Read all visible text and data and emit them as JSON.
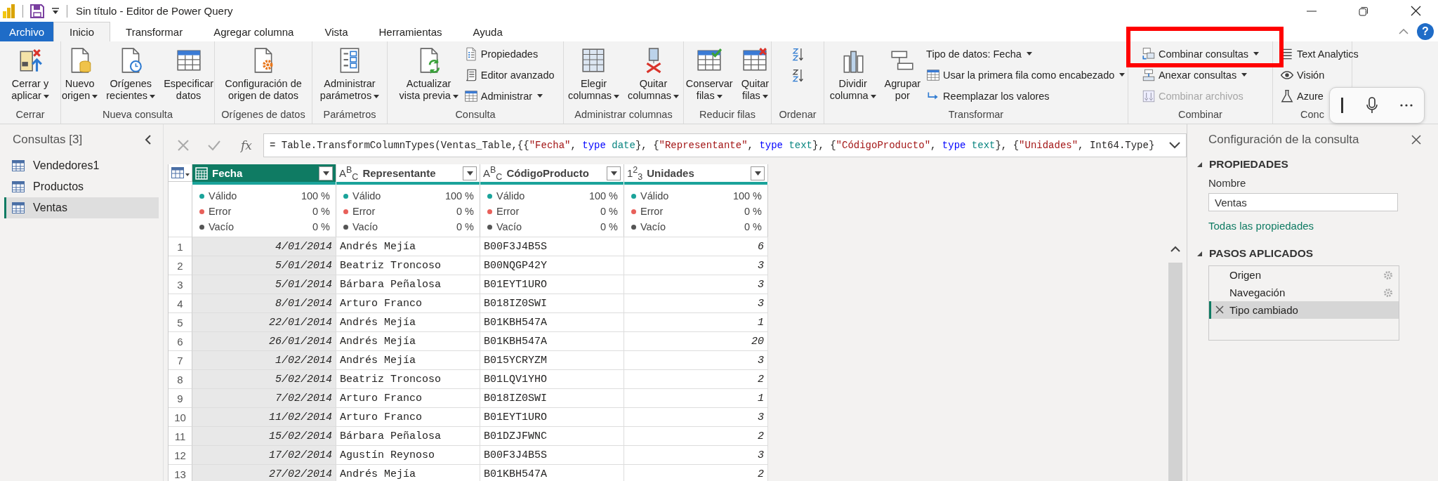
{
  "title_bar": {
    "title": "Sin título - Editor de Power Query"
  },
  "menu_tabs": [
    {
      "label": "Archivo",
      "kind": "file",
      "selected": false
    },
    {
      "label": "Inicio",
      "kind": "tab",
      "selected": true
    },
    {
      "label": "Transformar",
      "kind": "tab",
      "selected": false
    },
    {
      "label": "Agregar columna",
      "kind": "tab",
      "selected": false
    },
    {
      "label": "Vista",
      "kind": "tab",
      "selected": false
    },
    {
      "label": "Herramientas",
      "kind": "tab",
      "selected": false
    },
    {
      "label": "Ayuda",
      "kind": "tab",
      "selected": false
    }
  ],
  "help_label": "?",
  "ribbon": [
    {
      "label": "Cerrar",
      "items": [
        {
          "kind": "large",
          "lines": [
            "Cerrar y",
            "aplicar"
          ],
          "dropdown": true
        }
      ]
    },
    {
      "label": "Nueva consulta",
      "items": [
        {
          "kind": "large",
          "lines": [
            "Nuevo",
            "origen"
          ],
          "dropdown": true
        },
        {
          "kind": "large",
          "lines": [
            "Orígenes",
            "recientes"
          ],
          "dropdown": true
        },
        {
          "kind": "large",
          "lines": [
            "Especificar",
            "datos"
          ]
        }
      ]
    },
    {
      "label": "Orígenes de datos",
      "items": [
        {
          "kind": "large",
          "lines": [
            "Configuración de",
            "origen de datos"
          ]
        }
      ]
    },
    {
      "label": "Parámetros",
      "items": [
        {
          "kind": "large",
          "lines": [
            "Administrar",
            "parámetros"
          ],
          "dropdown": true
        }
      ]
    },
    {
      "label": "Consulta",
      "items": [
        {
          "kind": "large",
          "lines": [
            "Actualizar",
            "vista previa"
          ],
          "dropdown": true
        },
        {
          "kind": "small",
          "label": "Propiedades"
        },
        {
          "kind": "small",
          "label": "Editor avanzado"
        },
        {
          "kind": "small",
          "label": "Administrar",
          "dropdown": true
        }
      ]
    },
    {
      "label": "Administrar columnas",
      "items": [
        {
          "kind": "large",
          "lines": [
            "Elegir",
            "columnas"
          ],
          "dropdown": true
        },
        {
          "kind": "large",
          "lines": [
            "Quitar",
            "columnas"
          ],
          "dropdown": true
        }
      ]
    },
    {
      "label": "Reducir filas",
      "items": [
        {
          "kind": "large",
          "lines": [
            "Conservar",
            "filas"
          ],
          "dropdown": true
        },
        {
          "kind": "large",
          "lines": [
            "Quitar",
            "filas"
          ],
          "dropdown": true
        }
      ]
    },
    {
      "label": "Ordenar",
      "items": [
        {
          "kind": "icon"
        },
        {
          "kind": "icon"
        }
      ]
    },
    {
      "label": "Transformar",
      "items": [
        {
          "kind": "large",
          "lines": [
            "Dividir",
            "columna"
          ],
          "dropdown": true
        },
        {
          "kind": "large",
          "lines": [
            "Agrupar",
            "por"
          ]
        },
        {
          "kind": "small",
          "label": "Tipo de datos: Fecha",
          "dropdown": true
        },
        {
          "kind": "small",
          "label": "Usar la primera fila como encabezado",
          "dropdown": true
        },
        {
          "kind": "small",
          "label": "Reemplazar los valores"
        }
      ]
    },
    {
      "label": "Combinar",
      "items": [
        {
          "kind": "small",
          "label": "Combinar consultas",
          "dropdown": true,
          "disabled": false
        },
        {
          "kind": "small",
          "label": "Anexar consultas",
          "dropdown": true,
          "disabled": false
        },
        {
          "kind": "small",
          "label": "Combinar archivos",
          "disabled": true
        }
      ]
    },
    {
      "label": "Conc",
      "items": [
        {
          "kind": "small",
          "label": "Text Analytics"
        },
        {
          "kind": "small",
          "label": "Visión"
        },
        {
          "kind": "small",
          "label": "Azure"
        }
      ]
    }
  ],
  "queries": {
    "title": "Consultas [3]",
    "items": [
      {
        "label": "Vendedores1",
        "selected": false
      },
      {
        "label": "Productos",
        "selected": false
      },
      {
        "label": "Ventas",
        "selected": true
      }
    ]
  },
  "formula_bar": {
    "function_label": "fx",
    "tokens": [
      {
        "kind": "plain",
        "text": "= Table.TransformColumnTypes(Ventas_Table,{{"
      },
      {
        "kind": "string",
        "text": "\"Fecha\""
      },
      {
        "kind": "plain",
        "text": ", "
      },
      {
        "kind": "keyword",
        "text": "type"
      },
      {
        "kind": "type",
        "text": " date"
      },
      {
        "kind": "plain",
        "text": "}, {"
      },
      {
        "kind": "string",
        "text": "\"Representante\""
      },
      {
        "kind": "plain",
        "text": ", "
      },
      {
        "kind": "keyword",
        "text": "type"
      },
      {
        "kind": "type",
        "text": " text"
      },
      {
        "kind": "plain",
        "text": "}, {"
      },
      {
        "kind": "string",
        "text": "\"CódigoProducto\""
      },
      {
        "kind": "plain",
        "text": ", "
      },
      {
        "kind": "keyword",
        "text": "type"
      },
      {
        "kind": "type",
        "text": " text"
      },
      {
        "kind": "plain",
        "text": "}, {"
      },
      {
        "kind": "string",
        "text": "\"Unidades\""
      },
      {
        "kind": "plain",
        "text": ", Int64.Type}"
      }
    ]
  },
  "table": {
    "columns": [
      {
        "name": "Fecha",
        "kind": "date",
        "selected": true,
        "level": 1,
        "quality": [
          {
            "label": "Válido",
            "value": "100 %",
            "color": "#1aa39a"
          },
          {
            "label": "Error",
            "value": "0 %",
            "color": "#e8605a"
          },
          {
            "label": "Vacío",
            "value": "0 %",
            "color": "#555555"
          }
        ]
      },
      {
        "name": "Representante",
        "kind": "text",
        "type_label": "A$^{B}$$_{C}$",
        "selected": false,
        "level": 1,
        "quality": [
          {
            "label": "Válido",
            "value": "100 %",
            "color": "#1aa39a"
          },
          {
            "label": "Error",
            "value": "0 %",
            "color": "#e8605a"
          },
          {
            "label": "Vacío",
            "value": "0 %",
            "color": "#555555"
          }
        ]
      },
      {
        "name": "CódigoProducto",
        "kind": "text",
        "type_label": "A$^{B}$$_{C}$",
        "selected": false,
        "level": 1,
        "quality": [
          {
            "label": "Válido",
            "value": "100 %",
            "color": "#1aa39a"
          },
          {
            "label": "Error",
            "value": "0 %",
            "color": "#e8605a"
          },
          {
            "label": "Vacío",
            "value": "0 %",
            "color": "#555555"
          }
        ]
      },
      {
        "name": "Unidades",
        "kind": "number",
        "type_label": "1$^{2}$$_{3}$",
        "selected": false,
        "level": 1,
        "quality": [
          {
            "label": "Válido",
            "value": "100 %",
            "color": "#1aa39a"
          },
          {
            "label": "Error",
            "value": "0 %",
            "color": "#e8605a"
          },
          {
            "label": "Vacío",
            "value": "0 %",
            "color": "#555555"
          }
        ]
      }
    ],
    "rows": [
      {
        "number": "1",
        "cells": [
          "4/01/2014",
          "Andrés Mejía",
          "B00F3J4B5S",
          "6"
        ]
      },
      {
        "number": "2",
        "cells": [
          "5/01/2014",
          "Beatriz Troncoso",
          "B00NQGP42Y",
          "3"
        ]
      },
      {
        "number": "3",
        "cells": [
          "5/01/2014",
          "Bárbara Peñalosa",
          "B01EYT1URO",
          "3"
        ]
      },
      {
        "number": "4",
        "cells": [
          "8/01/2014",
          "Arturo Franco",
          "B018IZ0SWI",
          "3"
        ]
      },
      {
        "number": "5",
        "cells": [
          "22/01/2014",
          "Andrés Mejía",
          "B01KBH547A",
          "1"
        ]
      },
      {
        "number": "6",
        "cells": [
          "26/01/2014",
          "Andrés Mejía",
          "B01KBH547A",
          "20"
        ]
      },
      {
        "number": "7",
        "cells": [
          "1/02/2014",
          "Andrés Mejía",
          "B015YCRYZM",
          "3"
        ]
      },
      {
        "number": "8",
        "cells": [
          "5/02/2014",
          "Beatriz Troncoso",
          "B01LQV1YHO",
          "2"
        ]
      },
      {
        "number": "9",
        "cells": [
          "7/02/2014",
          "Arturo Franco",
          "B018IZ0SWI",
          "1"
        ]
      },
      {
        "number": "10",
        "cells": [
          "11/02/2014",
          "Arturo Franco",
          "B01EYT1URO",
          "3"
        ]
      },
      {
        "number": "11",
        "cells": [
          "15/02/2014",
          "Bárbara Peñalosa",
          "B01DZJFWNC",
          "2"
        ]
      },
      {
        "number": "12",
        "cells": [
          "17/02/2014",
          "Agustín Reynoso",
          "B00F3J4B5S",
          "3"
        ]
      },
      {
        "number": "13",
        "cells": [
          "27/02/2014",
          "Andrés Mejía",
          "B01KBH547A",
          "2"
        ]
      }
    ]
  },
  "settings_pane": {
    "title": "Configuración de la consulta",
    "properties_heading": "PROPIEDADES",
    "name_label": "Nombre",
    "name_value": "Ventas",
    "all_properties_link": "Todas las propiedades",
    "steps_heading": "PASOS APLICADOS",
    "steps": [
      {
        "label": "Origen",
        "selected": false,
        "settings": true
      },
      {
        "label": "Navegación",
        "selected": false,
        "settings": true
      },
      {
        "label": "Tipo cambiado",
        "selected": true,
        "settings": false
      }
    ]
  }
}
